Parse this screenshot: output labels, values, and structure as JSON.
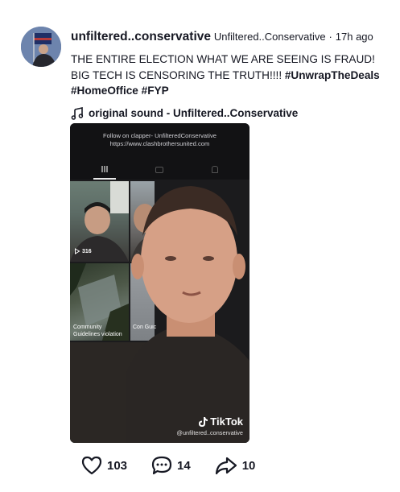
{
  "post": {
    "username": "unfiltered..conservative",
    "nickname": "Unfiltered..Conservative",
    "separator": "·",
    "time_ago": "17h ago",
    "caption_text": "THE ENTIRE ELECTION WHAT WE ARE SEEING IS FRAUD! BIG TECH IS CENSORING THE TRUTH!!!! ",
    "hashtags": [
      "#UnwrapTheDeals",
      "#HomeOffice",
      "#FYP"
    ],
    "sound_icon": "music-note-icon",
    "sound": "original sound - Unfiltered..Conservative"
  },
  "video": {
    "follow_line1": "Follow on clapper- UnfilteredConservative",
    "follow_line2": "https://www.clashbrothersunited.com",
    "view_count": "316",
    "violation_text": "Community Guidelines violation",
    "violation_text_partial": "Con Guic",
    "watermark_brand": "TikTok",
    "watermark_handle": "@unfiltered..conservative",
    "play_icon": "play-icon"
  },
  "actions": {
    "likes": "103",
    "comments": "14",
    "shares": "10",
    "like_icon": "heart-icon",
    "comment_icon": "comment-icon",
    "share_icon": "share-arrow-icon"
  }
}
